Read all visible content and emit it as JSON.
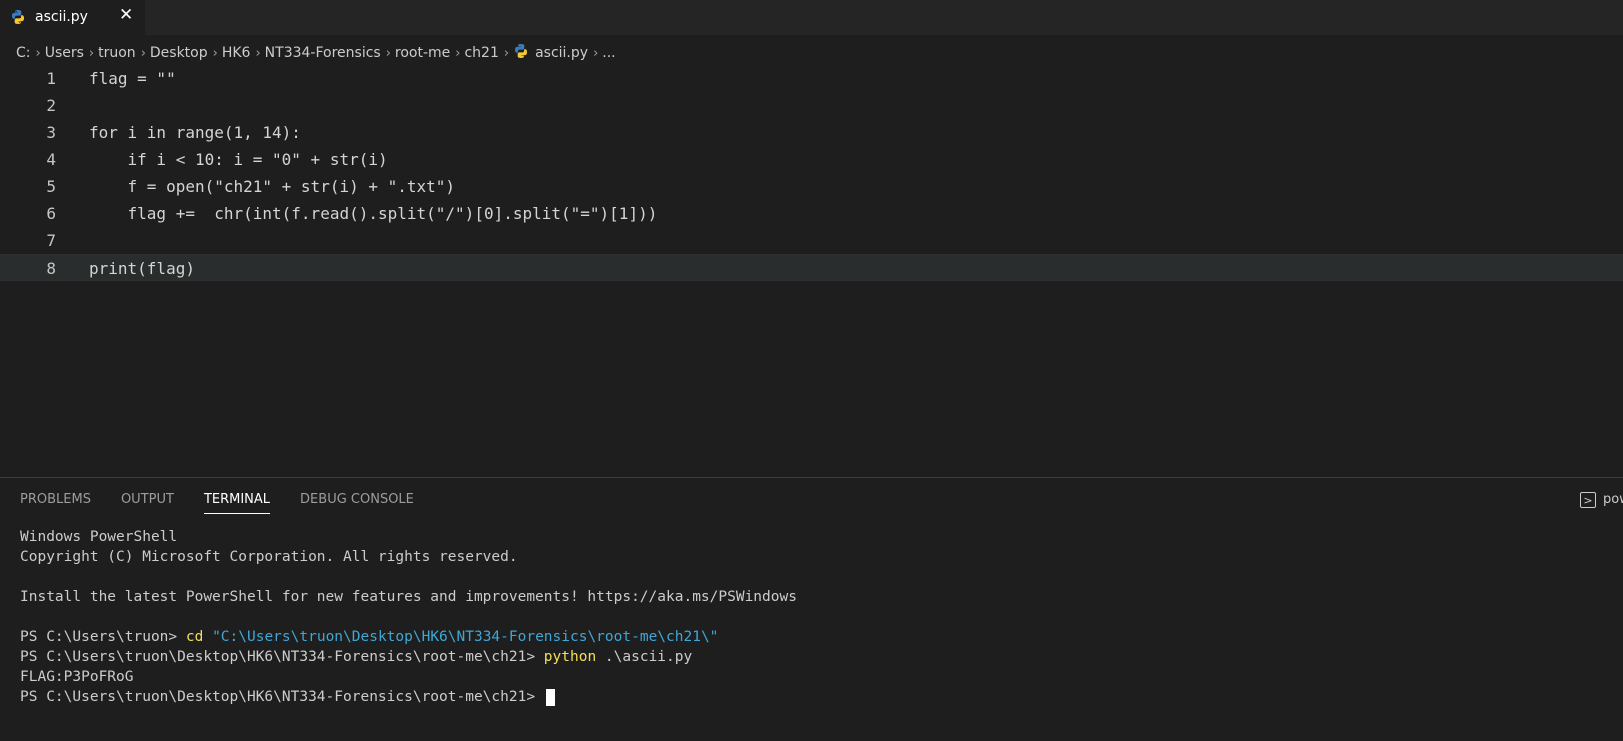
{
  "tab": {
    "label": "ascii.py",
    "close": "✕",
    "icon": "python-icon"
  },
  "breadcrumb": {
    "parts": [
      "C:",
      "Users",
      "truon",
      "Desktop",
      "HK6",
      "NT334-Forensics",
      "root-me",
      "ch21",
      "ascii.py",
      "..."
    ],
    "separator": "›"
  },
  "editor": {
    "line_numbers": [
      "1",
      "2",
      "3",
      "4",
      "5",
      "6",
      "7",
      "8"
    ],
    "lines": [
      "flag = \"\"",
      "",
      "for i in range(1, 14):",
      "    if i < 10: i = \"0\" + str(i)",
      "    f = open(\"ch21\" + str(i) + \".txt\")",
      "    flag +=  chr(int(f.read().split(\"/\")[0].split(\"=\")[1]))",
      "",
      "print(flag)"
    ]
  },
  "panel": {
    "tabs": [
      "PROBLEMS",
      "OUTPUT",
      "TERMINAL",
      "DEBUG CONSOLE"
    ],
    "active_tab": "TERMINAL",
    "terminal_label": "pow"
  },
  "terminal": {
    "lines": [
      "Windows PowerShell",
      "Copyright (C) Microsoft Corporation. All rights reserved.",
      "",
      "Install the latest PowerShell for new features and improvements! https://aka.ms/PSWindows",
      ""
    ],
    "cmd1_prompt": "PS C:\\Users\\truon> ",
    "cmd1_command": "cd",
    "cmd1_arg": "\"C:\\Users\\truon\\Desktop\\HK6\\NT334-Forensics\\root-me\\ch21\\\"",
    "cmd2_prompt": "PS C:\\Users\\truon\\Desktop\\HK6\\NT334-Forensics\\root-me\\ch21> ",
    "cmd2_command": "python",
    "cmd2_arg": " .\\ascii.py",
    "output": "FLAG:P3PoFRoG",
    "final_prompt": "PS C:\\Users\\truon\\Desktop\\HK6\\NT334-Forensics\\root-me\\ch21> "
  }
}
